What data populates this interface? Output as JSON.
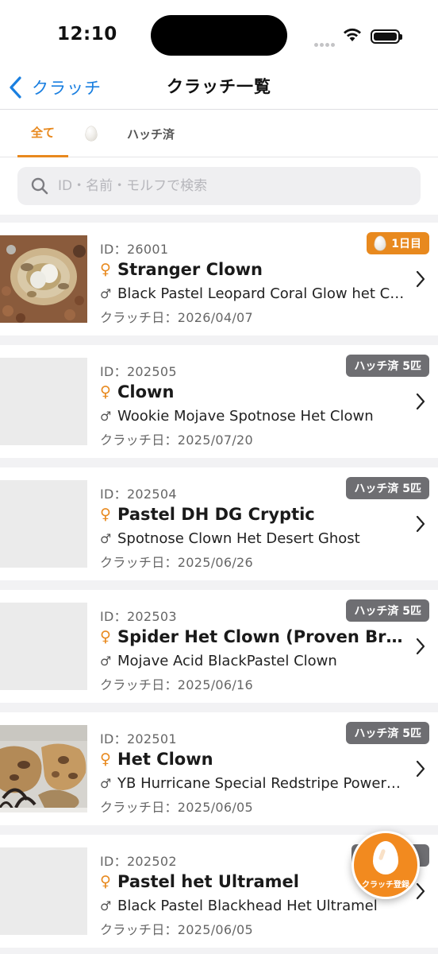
{
  "status_bar": {
    "time": "12:10"
  },
  "nav": {
    "back_label": "クラッチ",
    "title": "クラッチ一覧"
  },
  "tabs": [
    {
      "label": "全て",
      "active": true
    },
    {
      "icon": "egg-icon",
      "active": false
    },
    {
      "label": "ハッチ済",
      "active": false
    }
  ],
  "search": {
    "placeholder": "ID・名前・モルフで検索",
    "value": ""
  },
  "clutches": [
    {
      "id_text": "ID：26001",
      "female_symbol": "♀",
      "female": "Stranger Clown",
      "male_symbol": "♂",
      "male": "Black Pastel Leopard Coral Glow het Clown",
      "date_text": "クラッチ日：2026/04/07",
      "badge": "1日目",
      "badge_type": "incubating",
      "has_photo": true
    },
    {
      "id_text": "ID：202505",
      "female_symbol": "♀",
      "female": "Clown",
      "male_symbol": "♂",
      "male": "Wookie Mojave Spotnose Het Clown",
      "date_text": "クラッチ日：2025/07/20",
      "badge": "ハッチ済 5匹",
      "badge_type": "hatched",
      "has_photo": false
    },
    {
      "id_text": "ID：202504",
      "female_symbol": "♀",
      "female": "Pastel DH DG Cryptic",
      "male_symbol": "♂",
      "male": "Spotnose Clown Het Desert Ghost",
      "date_text": "クラッチ日：2025/06/26",
      "badge": "ハッチ済 5匹",
      "badge_type": "hatched",
      "has_photo": false
    },
    {
      "id_text": "ID：202503",
      "female_symbol": "♀",
      "female": "Spider Het Clown (Proven Breeder)",
      "male_symbol": "♂",
      "male": "Mojave Acid BlackPastel Clown",
      "date_text": "クラッチ日：2025/06/16",
      "badge": "ハッチ済 5匹",
      "badge_type": "hatched",
      "has_photo": false
    },
    {
      "id_text": "ID：202501",
      "female_symbol": "♀",
      "female": "Het Clown",
      "male_symbol": "♂",
      "male": "YB Hurricane Special Redstripe Powerball",
      "date_text": "クラッチ日：2025/06/05",
      "badge": "ハッチ済 5匹",
      "badge_type": "hatched",
      "has_photo": true
    },
    {
      "id_text": "ID：202502",
      "female_symbol": "♀",
      "female": "Pastel het Ultramel",
      "male_symbol": "♂",
      "male": "Black Pastel Blackhead Het Ultramel",
      "date_text": "クラッチ日：2025/06/05",
      "badge": "",
      "badge_type": "hatched",
      "has_photo": false
    }
  ],
  "fab": {
    "label": "クラッチ登録"
  },
  "colors": {
    "accent": "#e8891e",
    "link": "#1a7fe0",
    "badge_gray": "#6e6e72"
  }
}
